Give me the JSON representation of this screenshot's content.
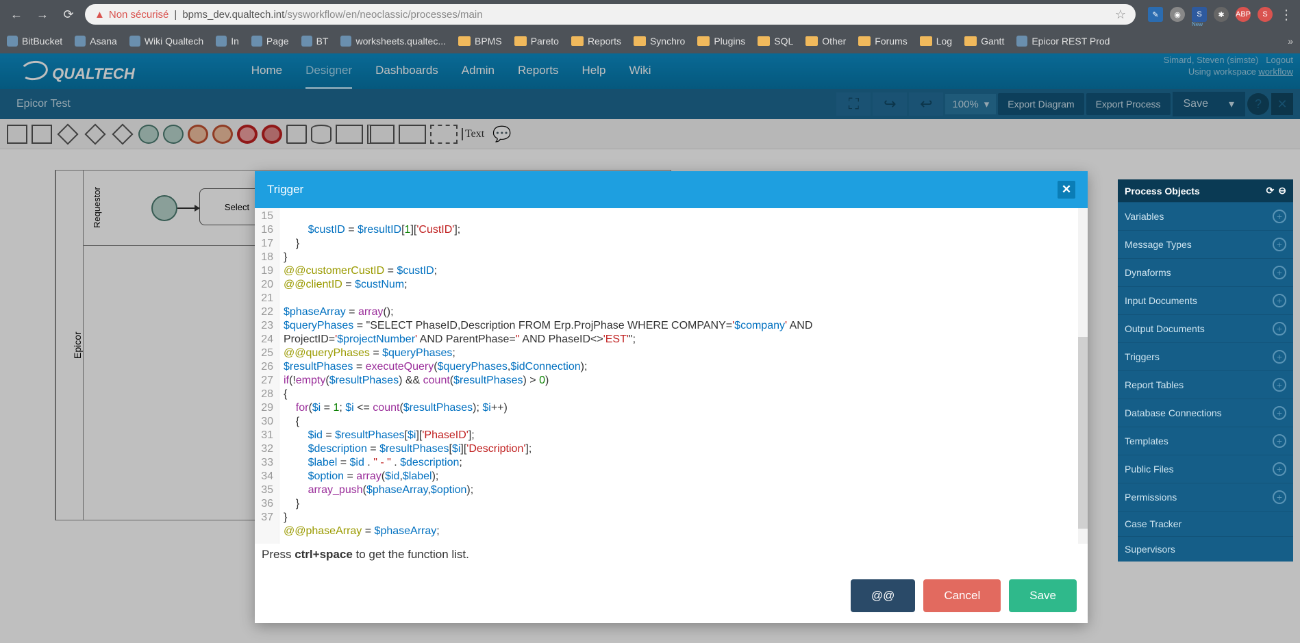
{
  "browser": {
    "url_prefix": "Non sécurisé",
    "url_host": "bpms_dev.qualtech.int",
    "url_path": "/sysworkflow/en/neoclassic/processes/main",
    "new_badge": "New"
  },
  "bookmarks": [
    "BitBucket",
    "Asana",
    "Wiki Qualtech",
    "In",
    "Page",
    "BT",
    "worksheets.qualtec...",
    "BPMS",
    "Pareto",
    "Reports",
    "Synchro",
    "Plugins",
    "SQL",
    "Other",
    "Forums",
    "Log",
    "Gantt",
    "Epicor REST Prod"
  ],
  "header": {
    "logo": "QUALTECH",
    "nav": [
      "Home",
      "Designer",
      "Dashboards",
      "Admin",
      "Reports",
      "Help",
      "Wiki"
    ],
    "active_nav": "Designer",
    "user": "Simard, Steven (simste)",
    "logout": "Logout",
    "workspace_prefix": "Using workspace ",
    "workspace": "workflow"
  },
  "toolbar": {
    "title": "Epicor Test",
    "zoom": "100%",
    "export_diagram": "Export Diagram",
    "export_process": "Export Process",
    "save": "Save"
  },
  "diagram": {
    "pool": "Epicor",
    "lane1": "Requestor",
    "task1": "Select"
  },
  "process_objects": {
    "title": "Process Objects",
    "items": [
      "Variables",
      "Message Types",
      "Dynaforms",
      "Input Documents",
      "Output Documents",
      "Triggers",
      "Report Tables",
      "Database Connections",
      "Templates",
      "Public Files",
      "Permissions",
      "Case Tracker",
      "Supervisors"
    ]
  },
  "modal": {
    "title": "Trigger",
    "hint_prefix": "Press ",
    "hint_key": "ctrl+space",
    "hint_suffix": " to get the function list.",
    "btn_at": "@@",
    "btn_cancel": "Cancel",
    "btn_save": "Save",
    "line_start": 15,
    "lines": [
      "",
      "        $custID = $resultID[1]['CustID'];",
      "    }",
      "}",
      "@@customerCustID = $custID;",
      "@@clientID = $custNum;",
      "",
      "$phaseArray = array();",
      "$queryPhases = \"SELECT PhaseID,Description FROM Erp.ProjPhase WHERE COMPANY='$company' AND ProjectID='$projectNumber' AND ParentPhase='' AND PhaseID<>'EST'\";",
      "@@queryPhases = $queryPhases;",
      "$resultPhases = executeQuery($queryPhases,$idConnection);",
      "if(!empty($resultPhases) && count($resultPhases) > 0)",
      "{",
      "    for($i = 1; $i <= count($resultPhases); $i++)",
      "    {",
      "        $id = $resultPhases[$i]['PhaseID'];",
      "        $description = $resultPhases[$i]['Description'];",
      "        $label = $id . \" - \" . $description;",
      "        $option = array($id,$label);",
      "        array_push($phaseArray,$option);",
      "    }",
      "}",
      "@@phaseArray = $phaseArray;"
    ]
  }
}
